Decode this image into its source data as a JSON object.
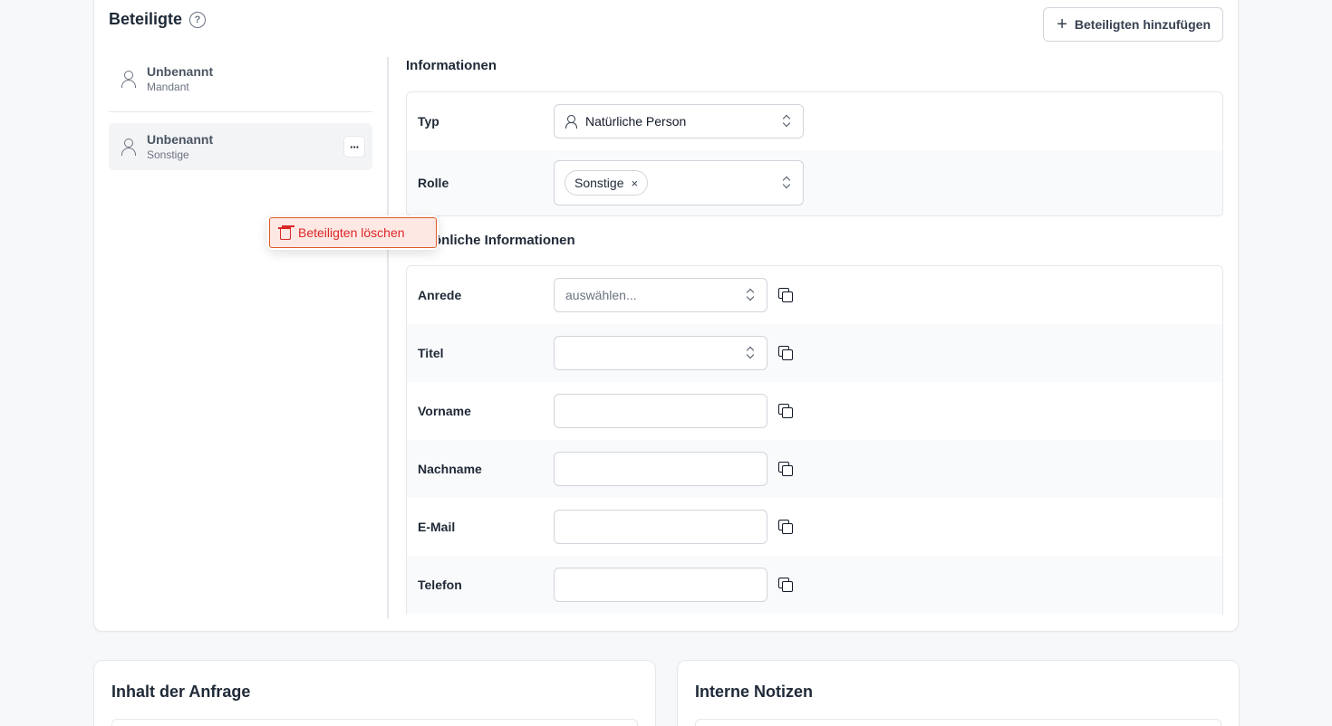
{
  "participants_section": {
    "title": "Beteiligte",
    "help_icon": "?",
    "add_button_label": "Beteiligten hinzufügen",
    "add_button_icon": "+"
  },
  "participants": [
    {
      "name": "Unbenannt",
      "role": "Mandant"
    },
    {
      "name": "Unbenannt",
      "role": "Sonstige",
      "selected": true,
      "more_label": "···"
    }
  ],
  "context_menu": {
    "delete_label": "Beteiligten löschen",
    "accent": "#dc2626"
  },
  "info_section": {
    "heading": "Informationen",
    "typ_label": "Typ",
    "typ_value": "Natürliche Person",
    "rolle_label": "Rolle",
    "rolle_tag": "Sonstige",
    "rolle_tag_remove": "×"
  },
  "personal_section": {
    "heading": "önliche Informationen",
    "anrede_label": "Anrede",
    "anrede_placeholder": "auswählen...",
    "titel_label": "Titel",
    "vorname_label": "Vorname",
    "nachname_label": "Nachname",
    "email_label": "E-Mail",
    "telefon_label": "Telefon"
  },
  "request_card": {
    "title": "Inhalt der Anfrage"
  },
  "notes_card": {
    "title": "Interne Notizen"
  }
}
